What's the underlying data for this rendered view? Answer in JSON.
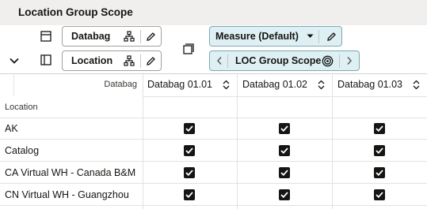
{
  "window": {
    "title": "Location Group Scope"
  },
  "toolbar": {
    "dimension_1": {
      "label": "Databag",
      "icons": [
        "hierarchy-icon",
        "pencil-icon"
      ]
    },
    "dimension_2": {
      "label": "Location",
      "icons": [
        "hierarchy-icon",
        "pencil-icon"
      ]
    },
    "measure": {
      "label": "Measure (Default)",
      "icons": [
        "caret-down-icon",
        "pencil-icon"
      ]
    },
    "scope": {
      "label": "LOC Group Scope",
      "icons": [
        "chevron-left-icon",
        "target-icon",
        "chevron-right-icon"
      ]
    },
    "colors": {
      "header_bg": "#f1efed",
      "teal_bg": "#def0f4",
      "teal_border": "#7fa7b3"
    }
  },
  "grid": {
    "corner_label": "Databag",
    "row_header_label": "Location",
    "columns": [
      "Databag 01.01",
      "Databag 01.02",
      "Databag 01.03"
    ],
    "rows": [
      {
        "label": "AK",
        "checked": [
          true,
          true,
          true
        ]
      },
      {
        "label": "Catalog",
        "checked": [
          true,
          true,
          true
        ]
      },
      {
        "label": "CA Virtual WH - Canada B&M",
        "checked": [
          true,
          true,
          true
        ]
      },
      {
        "label": "CN Virtual WH - Guangzhou",
        "checked": [
          true,
          true,
          true
        ]
      }
    ]
  }
}
